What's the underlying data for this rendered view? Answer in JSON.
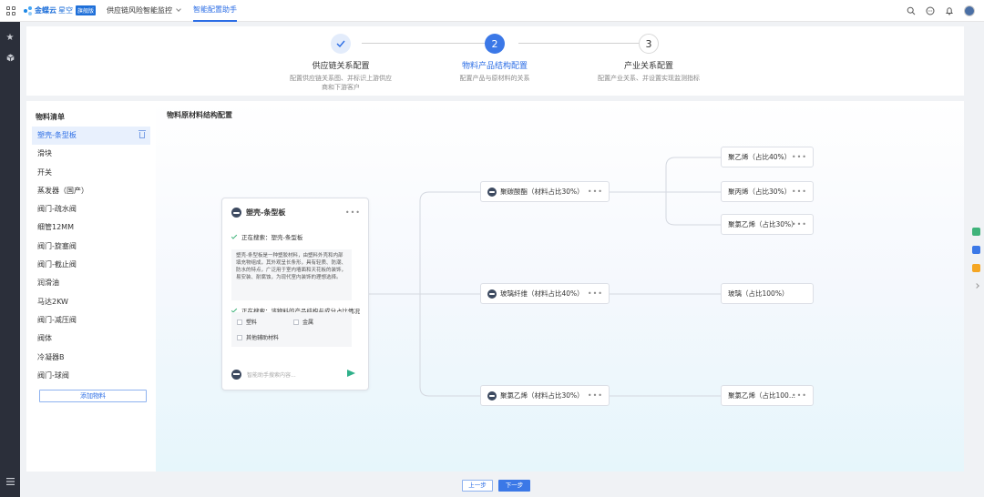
{
  "topbar": {
    "brand": "金蝶云",
    "brand_sub": "星空",
    "brand_badge": "旗舰版",
    "nav": [
      {
        "label": "供应链风险智能监控",
        "has_dropdown": true,
        "active": false
      },
      {
        "label": "智能配置助手",
        "active": true
      }
    ],
    "icons": [
      "search-icon",
      "message-icon",
      "bell-icon",
      "avatar"
    ]
  },
  "sidebar": {
    "icons": [
      "star-icon",
      "cube-icon",
      "menu-icon"
    ]
  },
  "steps": [
    {
      "index": "✓",
      "title": "供应链关系配置",
      "desc": "配置供应链关系图、并标识上游供应商和下游客户",
      "state": "done"
    },
    {
      "index": "2",
      "title": "物料产品结构配置",
      "desc": "配置产品与原材料的关系",
      "state": "active"
    },
    {
      "index": "3",
      "title": "产业关系配置",
      "desc": "配置产业关系、并设置实现监测指标",
      "state": "todo"
    }
  ],
  "material_list": {
    "title": "物料清单",
    "items": [
      "塑壳-条型板",
      "滑块",
      "开关",
      "蒸发器（国产）",
      "阀门-疏水阀",
      "细管12MM",
      "阀门-旋塞阀",
      "阀门-截止阀",
      "润滑油",
      "马达2KW",
      "阀门-减压阀",
      "阀体",
      "冷凝器B",
      "阀门-球阀"
    ],
    "selected_index": 0,
    "add_label": "添加物料"
  },
  "canvas": {
    "title": "物料原材料结构配置"
  },
  "chat_card": {
    "title": "塑壳-条型板",
    "search_line_1": "正在搜索：塑壳-条型板",
    "description": "塑壳-条型板是一种塑胶材料，由塑料外壳和内部填充物组成，其外观呈长条形，具有轻质、防潮、防水的特点，广泛用于室内墙面和天花板的装饰，易安装、耐腐蚀，为现代室内装饰的理想选择。",
    "search_line_2": "正在搜索：该物料的产品结构与成分占比情况",
    "options": [
      "塑料",
      "金属",
      "其他辅助材料"
    ],
    "input_placeholder": "智能助手搜索内容..."
  },
  "tree": {
    "mid_nodes": [
      "聚碳酸酯（材料占比30%）",
      "玻璃纤维（材料占比40%）",
      "聚氯乙烯（材料占比30%）"
    ],
    "leaf_nodes": [
      "聚乙烯（占比40%）",
      "聚丙烯（占比30%）",
      "聚氯乙烯（占比30%）",
      "玻璃（占比100%）",
      "聚氯乙烯（占比100..."
    ],
    "more_symbol": "•••"
  },
  "footer": {
    "prev_label": "上一步",
    "next_label": "下一步"
  },
  "colors": {
    "primary": "#3b78e7",
    "sidebar_bg": "#2b2f3a",
    "check_green": "#3fb37a"
  }
}
